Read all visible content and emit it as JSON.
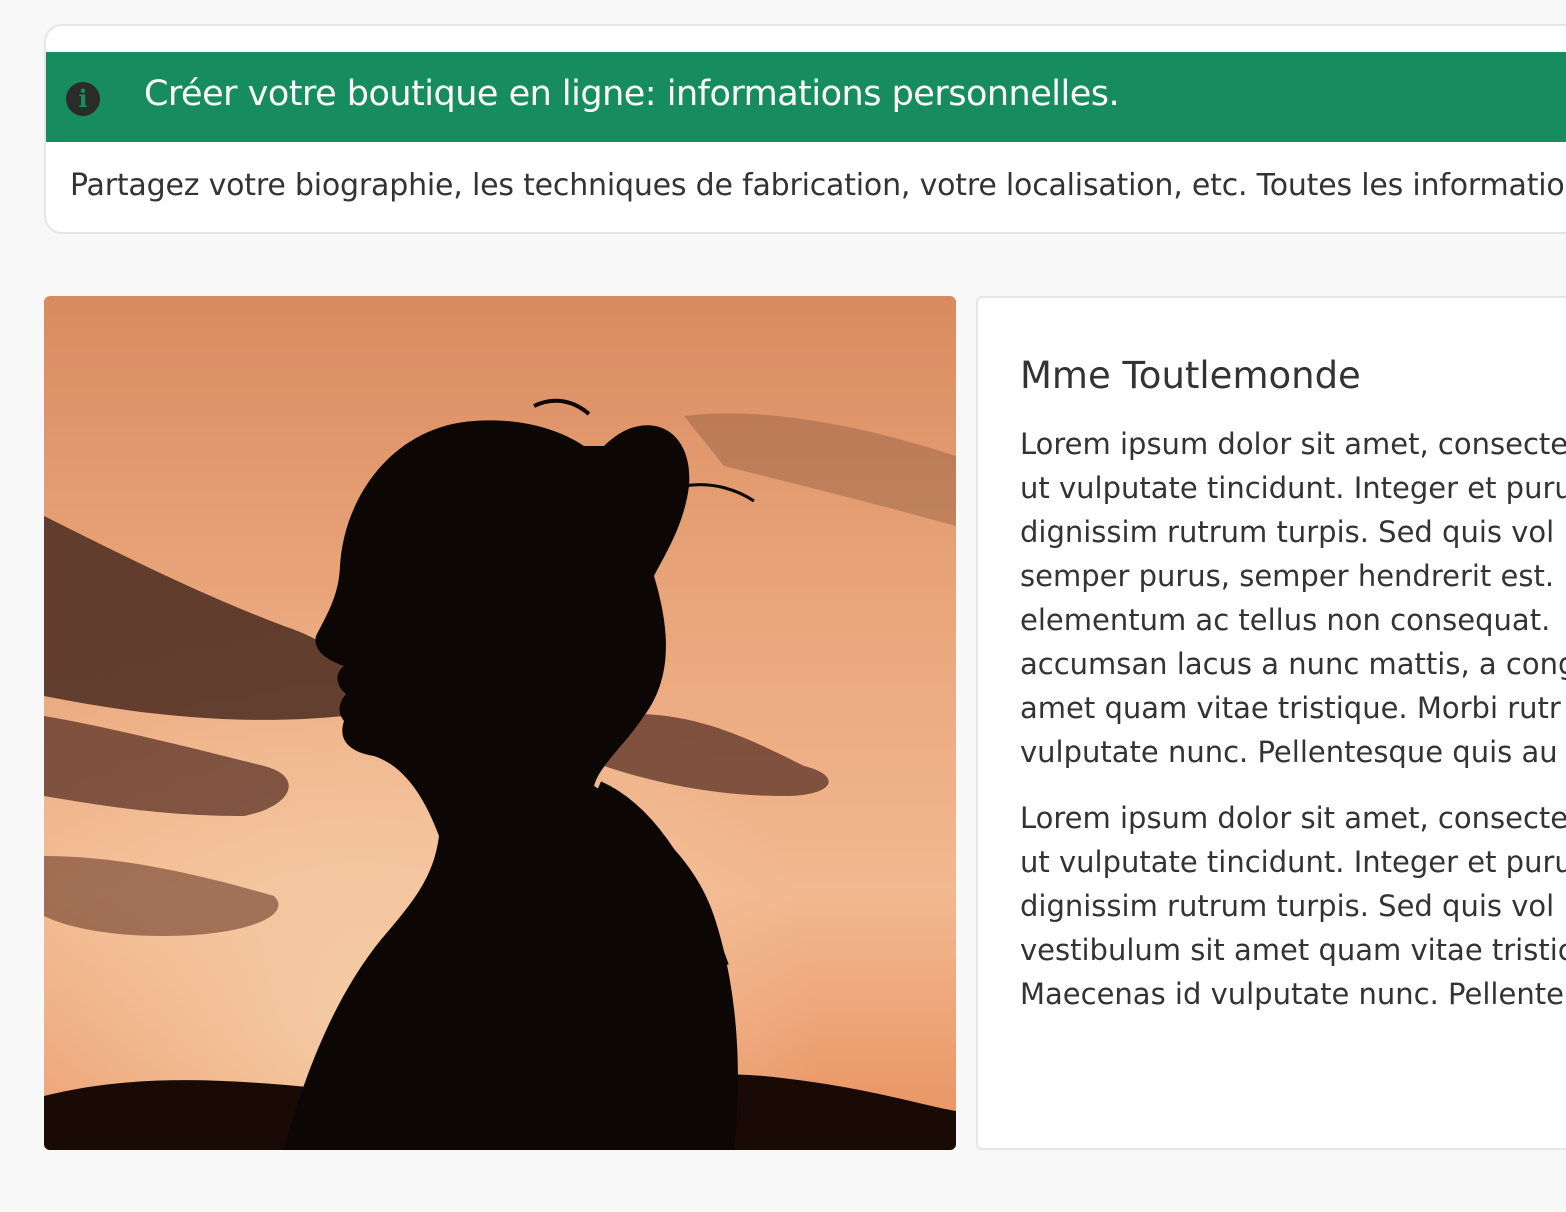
{
  "info": {
    "icon": "info-circle-icon",
    "title": "Créer votre boutique en ligne: informations personnelles.",
    "description": "Partagez votre biographie, les techniques de fabrication, votre localisation, etc. Toutes les informatio",
    "header_color": "#178d5f"
  },
  "profile": {
    "photo": "woman-silhouette-sunset-photo",
    "name": "Mme Toutlemonde",
    "paragraph1": [
      "Lorem ipsum dolor sit amet, consecte",
      "ut vulputate tincidunt. Integer et puru",
      "dignissim rutrum turpis. Sed quis vol",
      "semper purus, semper hendrerit est.",
      "elementum ac tellus non consequat.",
      "accumsan lacus a nunc mattis, a cong",
      "amet quam vitae tristique. Morbi rutr",
      "vulputate nunc. Pellentesque quis au"
    ],
    "paragraph2": [
      "Lorem ipsum dolor sit amet, consecte",
      "ut vulputate tincidunt. Integer et puru",
      "dignissim rutrum turpis. Sed quis vol",
      "vestibulum sit amet quam vitae tristic",
      "Maecenas id vulputate nunc. Pellente"
    ]
  }
}
